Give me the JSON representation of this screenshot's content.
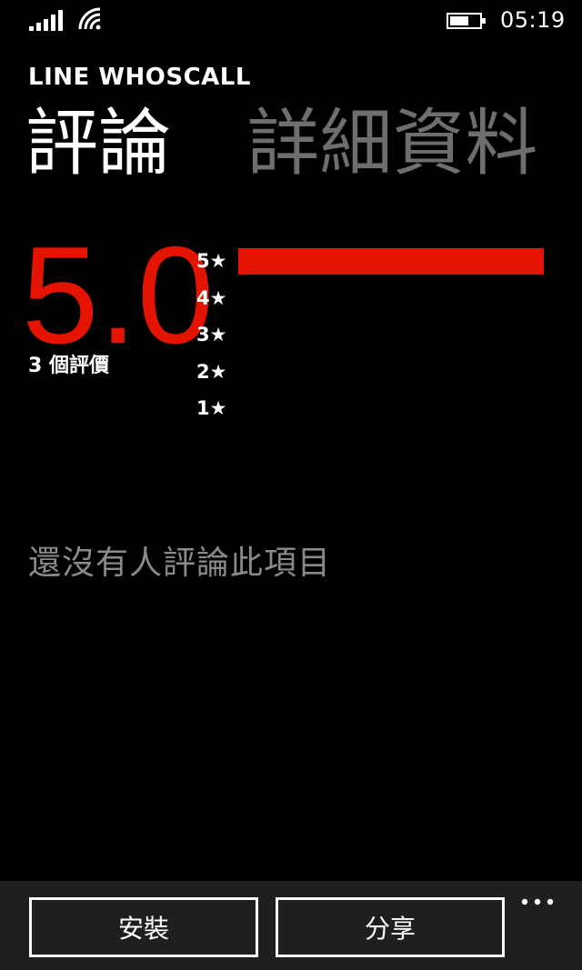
{
  "status_bar": {
    "time": "05:19",
    "icons": [
      "signal-strength-icon",
      "wifi-icon",
      "battery-icon"
    ]
  },
  "app": {
    "title": "LINE WHOSCALL"
  },
  "pivot": {
    "tabs": [
      {
        "label": "評論",
        "active": true
      },
      {
        "label": "詳細資料",
        "active": false
      }
    ]
  },
  "rating": {
    "average": "5.0",
    "count_text": "3 個評價",
    "histogram": [
      {
        "label": "5★",
        "fraction": 1.0
      },
      {
        "label": "4★",
        "fraction": 0
      },
      {
        "label": "3★",
        "fraction": 0
      },
      {
        "label": "2★",
        "fraction": 0
      },
      {
        "label": "1★",
        "fraction": 0
      }
    ]
  },
  "reviews": {
    "empty_message": "還沒有人評論此項目"
  },
  "app_bar": {
    "install_label": "安裝",
    "share_label": "分享",
    "more_icon": "more-dots-icon"
  },
  "colors": {
    "accent": "#e51400",
    "background": "#000000",
    "app_bar": "#1f1f1f",
    "inactive_text": "#6e6e6e"
  }
}
